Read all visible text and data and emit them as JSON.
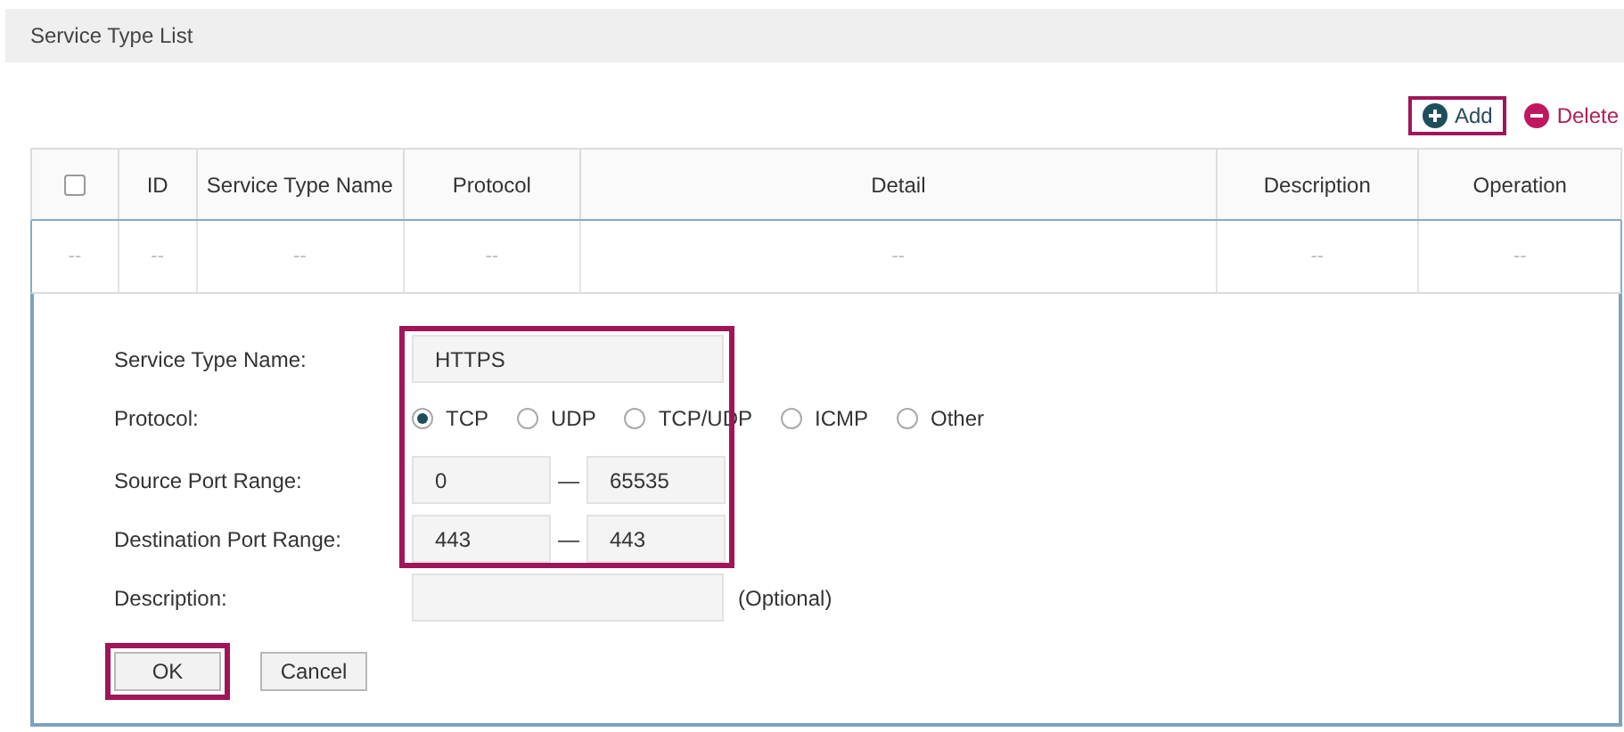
{
  "panel_title": "Service Type List",
  "toolbar": {
    "add": {
      "label": "Add",
      "highlighted": true
    },
    "delete": {
      "label": "Delete",
      "highlighted": false
    }
  },
  "table": {
    "columns": [
      {
        "kind": "checkbox",
        "checked": false
      },
      "ID",
      "Service Type Name",
      "Protocol",
      "Detail",
      "Description",
      "Operation"
    ],
    "rows": [
      [
        "--",
        "--",
        "--",
        "--",
        "--",
        "--",
        "--"
      ]
    ]
  },
  "form": {
    "highlighted": true,
    "name": {
      "label": "Service Type Name:",
      "value": "HTTPS"
    },
    "protocol": {
      "label": "Protocol:",
      "options": [
        {
          "label": "TCP",
          "selected": true
        },
        {
          "label": "UDP",
          "selected": false
        },
        {
          "label": "TCP/UDP",
          "selected": false
        },
        {
          "label": "ICMP",
          "selected": false
        },
        {
          "label": "Other",
          "selected": false
        }
      ]
    },
    "source_port": {
      "label": "Source Port Range:",
      "from": "0",
      "separator": "—",
      "to": "65535"
    },
    "destination_port": {
      "label": "Destination Port Range:",
      "from": "443",
      "separator": "—",
      "to": "443"
    },
    "description": {
      "label": "Description:",
      "hint": "(Optional)"
    },
    "buttons": [
      {
        "label": "OK",
        "highlighted": true
      },
      {
        "label": "Cancel",
        "highlighted": false
      }
    ]
  }
}
